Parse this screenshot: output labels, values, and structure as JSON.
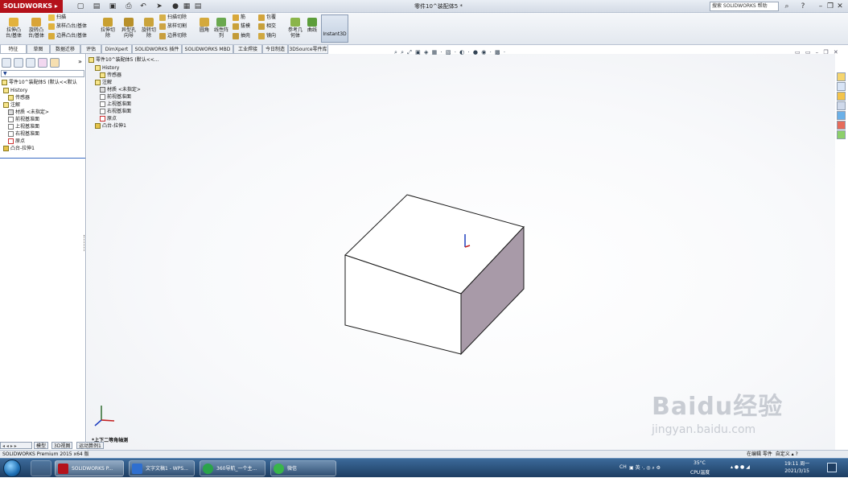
{
  "app": {
    "name": "SOLIDWORKS",
    "window_title": "零件10^装配体5 *",
    "help_search": "搜索 SOLIDWORKS 帮助"
  },
  "commands": {
    "large": [
      {
        "label": "拉伸凸\n台/基体",
        "color": "#e3b23c"
      },
      {
        "label": "旋转凸\n台/基体",
        "color": "#d9a438"
      },
      {
        "label": "拉伸切\n除",
        "color": "#c9a030"
      },
      {
        "label": "异型孔\n向导",
        "color": "#b8902a"
      },
      {
        "label": "旋转切\n除",
        "color": "#caa33a"
      },
      {
        "label": "圆角",
        "color": "#d4a93c"
      },
      {
        "label": "线性阵\n列",
        "color": "#6aa84f"
      },
      {
        "label": "参考几\n何体",
        "color": "#8bb54a"
      },
      {
        "label": "曲线",
        "color": "#5c9d3a"
      }
    ],
    "small": [
      {
        "label": "扫描"
      },
      {
        "label": "放样凸台/基体"
      },
      {
        "label": "边界凸台/基体"
      },
      {
        "label": "扫描切除"
      },
      {
        "label": "放样切割"
      },
      {
        "label": "边界切除"
      },
      {
        "label": "筋"
      },
      {
        "label": "拔模"
      },
      {
        "label": "抽壳"
      },
      {
        "label": "包覆"
      },
      {
        "label": "相交"
      },
      {
        "label": "镜向"
      }
    ],
    "instant3d": "Instant3D"
  },
  "tabs": [
    "特征",
    "草图",
    "数据迁移",
    "评估",
    "DimXpert",
    "SOLIDWORKS 插件",
    "SOLIDWORKS MBD",
    "工业焊接",
    "今日制造",
    "3DSource零件库"
  ],
  "feature_tree": {
    "root": "零件10^装配体5  (默认<<默认",
    "items": [
      "History",
      "传感器",
      "注解",
      "材质 <未指定>",
      "前视基准面",
      "上视基准面",
      "右视基准面",
      "原点",
      "凸台-拉伸1"
    ]
  },
  "viewport_tree": {
    "root": "零件10^装配体5  (默认<<...",
    "items": [
      "History",
      "传感器",
      "注解",
      "材质 <未指定>",
      "前视基准面",
      "上视基准面",
      "右视基准面",
      "原点",
      "凸台-拉伸1"
    ]
  },
  "view_label": "*上下二等角轴测",
  "bottom_tabs": [
    "模型",
    "3D视图",
    "运动算例1"
  ],
  "status": {
    "left": "SOLIDWORKS Premium 2015 x64 版",
    "right": "在编辑 零件",
    "units": "自定义"
  },
  "taskbar": {
    "buttons": [
      {
        "label": "SOLIDWORKS P...",
        "color": "#b4121b"
      },
      {
        "label": "文字文稿1 - WPS...",
        "color": "#2f6fcf"
      },
      {
        "label": "360导航_一个主...",
        "color": "#2aa34a"
      },
      {
        "label": "微信",
        "color": "#39b54a"
      }
    ],
    "tray": {
      "ime": "CH",
      "temp": "35°C",
      "cpu": "CPU温度"
    },
    "clock": {
      "time": "19:11 周一",
      "date": "2021/3/15"
    }
  },
  "watermark": {
    "brand": "Baidu经验",
    "url": "jingyan.baidu.com"
  }
}
